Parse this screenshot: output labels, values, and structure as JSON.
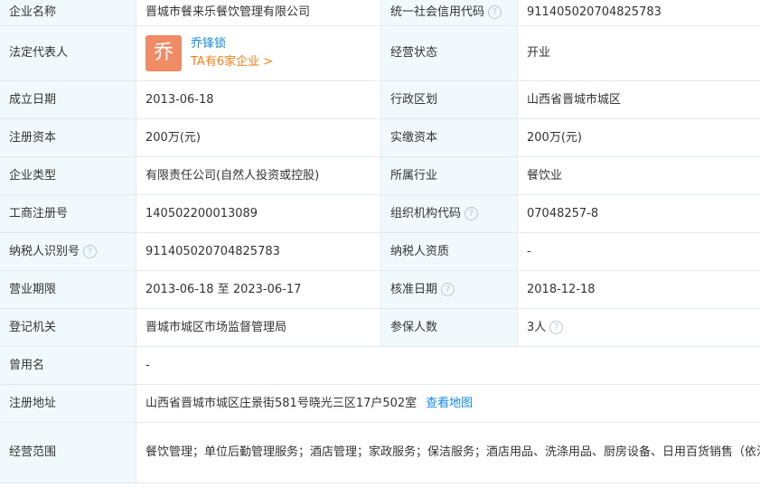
{
  "rows": {
    "r1": {
      "l1": "企业名称",
      "v1": "晋城市餐来乐餐饮管理有限公司",
      "l2": "统一社会信用代码",
      "v2": "911405020704825783"
    },
    "r2": {
      "l1": "法定代表人",
      "rep_avatar": "乔",
      "rep_name": "乔锋锁",
      "rep_companies": "TA有6家企业 >",
      "l2": "经营状态",
      "v2": "开业"
    },
    "r3": {
      "l1": "成立日期",
      "v1": "2013-06-18",
      "l2": "行政区划",
      "v2": "山西省晋城市城区"
    },
    "r4": {
      "l1": "注册资本",
      "v1": "200万(元)",
      "l2": "实缴资本",
      "v2": "200万(元)"
    },
    "r5": {
      "l1": "企业类型",
      "v1": "有限责任公司(自然人投资或控股)",
      "l2": "所属行业",
      "v2": "餐饮业"
    },
    "r6": {
      "l1": "工商注册号",
      "v1": "140502200013089",
      "l2": "组织机构代码",
      "v2": "07048257-8"
    },
    "r7": {
      "l1": "纳税人识别号",
      "v1": "911405020704825783",
      "l2": "纳税人资质",
      "v2": "-"
    },
    "r8": {
      "l1": "营业期限",
      "v1": "2013-06-18 至 2023-06-17",
      "l2": "核准日期",
      "v2": "2018-12-18"
    },
    "r9": {
      "l1": "登记机关",
      "v1": "晋城市城区市场监督管理局",
      "l2": "参保人数",
      "v2": "3人"
    },
    "r10": {
      "l1": "曾用名",
      "v1": "-"
    },
    "r11": {
      "l1": "注册地址",
      "v1": "山西省晋城市城区庄景街581号晓光三区17户502室",
      "map_link": "查看地图"
    },
    "r12": {
      "l1": "经营范围",
      "v1": "餐饮管理；单位后勤管理服务；酒店管理；家政服务；保洁服务；酒店用品、洗涤用品、厨房设备、日用百货销售（依法须经批准的项目，经相关部门批准后方可开展经营活动）"
    }
  },
  "help_icon": "question-circle-icon",
  "colors": {
    "label_bg": "#f2f9fc",
    "border": "#e4eaf2",
    "link": "#128bed",
    "orange": "#fd7e14",
    "avatar_bg": "#f18b66"
  }
}
